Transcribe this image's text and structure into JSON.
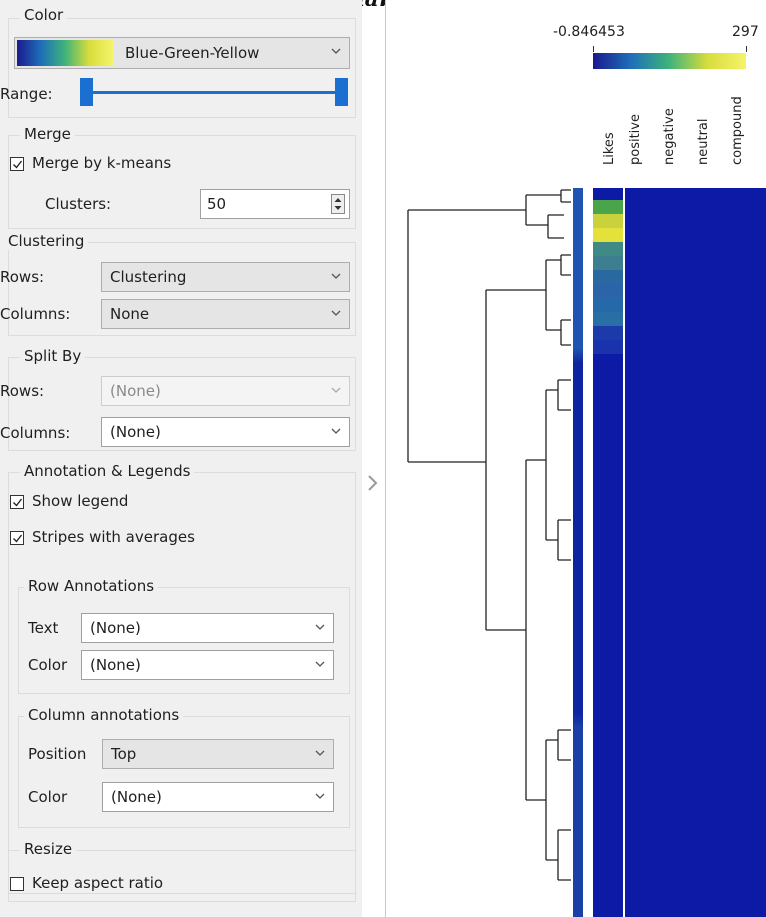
{
  "color_section": {
    "title": "Color",
    "scheme": "Blue-Green-Yellow",
    "range_label": "Range:"
  },
  "merge_section": {
    "title": "Merge",
    "merge_checkbox_label": "Merge by k-means",
    "merge_checked": true,
    "clusters_label": "Clusters:",
    "clusters_value": "50"
  },
  "clustering_section": {
    "title": "Clustering",
    "rows_label": "Rows:",
    "rows_value": "Clustering",
    "columns_label": "Columns:",
    "columns_value": "None"
  },
  "split_section": {
    "title": "Split By",
    "rows_label": "Rows:",
    "rows_value": "(None)",
    "columns_label": "Columns:",
    "columns_value": "(None)"
  },
  "annotation_section": {
    "title": "Annotation & Legends",
    "show_legend_label": "Show legend",
    "show_legend_checked": true,
    "stripes_label": "Stripes with averages",
    "stripes_checked": true
  },
  "row_annotations": {
    "title": "Row Annotations",
    "text_label": "Text",
    "text_value": "(None)",
    "color_label": "Color",
    "color_value": "(None)"
  },
  "column_annotations": {
    "title": "Column annotations",
    "position_label": "Position",
    "position_value": "Top",
    "color_label": "Color",
    "color_value": "(None)"
  },
  "resize_section": {
    "title": "Resize",
    "keep_aspect_label": "Keep aspect ratio",
    "keep_aspect_checked": false
  },
  "heatmap": {
    "legend_min": "-0.846453",
    "legend_max": "297",
    "gradient_colors": [
      "#1a1a8e",
      "#1e6fb8",
      "#3fb37a",
      "#d8dd3c",
      "#f4f46a"
    ],
    "columns": [
      "Likes",
      "positive",
      "negative",
      "neutral",
      "compound"
    ],
    "base_color": "#0c1aa6",
    "likes_column_colors": [
      "#49a44a",
      "#c9d13c",
      "#e4e13a",
      "#3f8a86",
      "#3d7f8e",
      "#2a68a2",
      "#2b64a8",
      "#2569a8",
      "#2a6ea6",
      "#1c3aa9",
      "#1a32ab"
    ],
    "stripe_colors": [
      "#1f55b0",
      "#1a3fa7",
      "#0f24a0"
    ]
  }
}
